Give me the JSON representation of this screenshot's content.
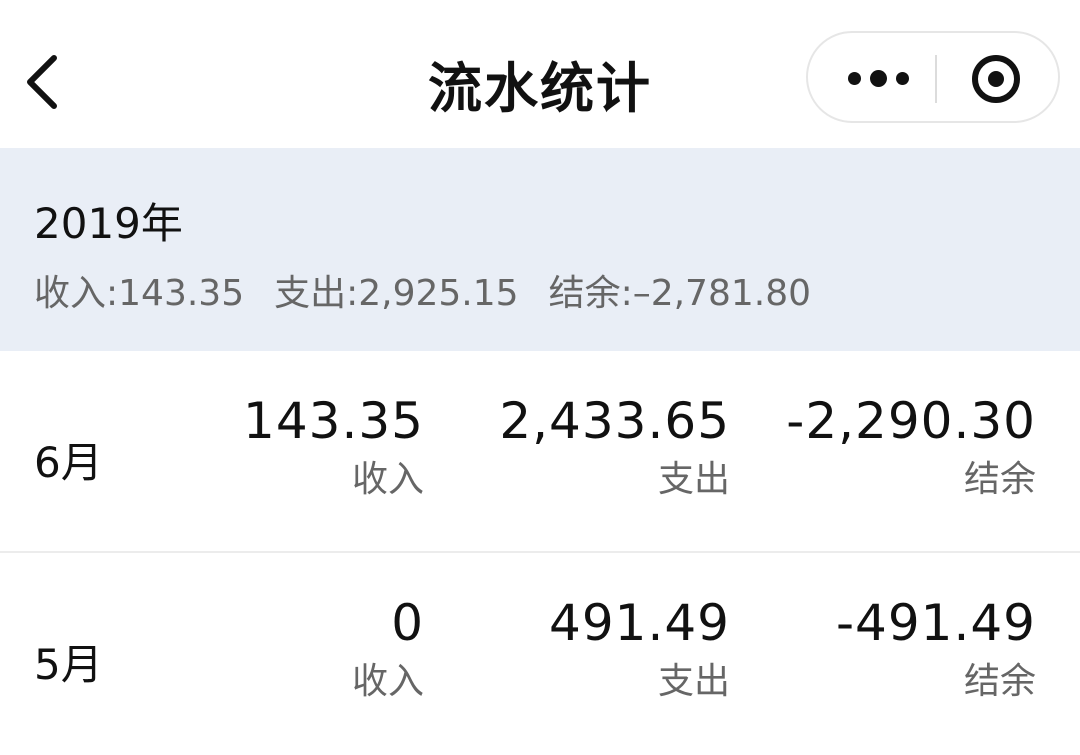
{
  "nav": {
    "title": "流水统计",
    "back_icon": "chevron-left-icon",
    "more_icon": "more-dots-icon",
    "close_icon": "target-circle-icon"
  },
  "summary": {
    "year": "2019年",
    "income": "收入:143.35",
    "expense": "支出:2,925.15",
    "balance": "结余:–2,781.80"
  },
  "months": [
    {
      "month": "6月",
      "income": "143.35",
      "income_label": "收入",
      "expense": "2,433.65",
      "expense_label": "支出",
      "balance": "-2,290.30",
      "balance_label": "结余"
    },
    {
      "month": "5月",
      "income": "0",
      "income_label": "收入",
      "expense": "491.49",
      "expense_label": "支出",
      "balance": "-491.49",
      "balance_label": "结余"
    }
  ],
  "colors": {
    "summary_bg": "#e9eef6",
    "text": "#111111",
    "secondary_text": "#666666"
  }
}
